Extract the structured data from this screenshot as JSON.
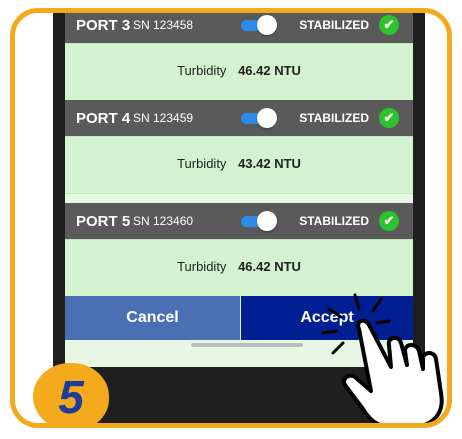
{
  "ports": [
    {
      "name": "PORT 3",
      "serial": "SN 123458",
      "status": "STABILIZED",
      "turbidity_label": "Turbidity",
      "turbidity_value": "46.42 NTU"
    },
    {
      "name": "PORT 4",
      "serial": "SN 123459",
      "status": "STABILIZED",
      "turbidity_label": "Turbidity",
      "turbidity_value": "43.42 NTU"
    },
    {
      "name": "PORT 5",
      "serial": "SN 123460",
      "status": "STABILIZED",
      "turbidity_label": "Turbidity",
      "turbidity_value": "46.42 NTU"
    }
  ],
  "buttons": {
    "cancel": "Cancel",
    "accept": "Accept"
  },
  "step_number": "5",
  "colors": {
    "accent": "#f5a91c",
    "accept": "#001f92",
    "cancel": "#4b6fb3",
    "header": "#5a5a5a",
    "row": "#d3f2cf",
    "check": "#2ec22e"
  }
}
